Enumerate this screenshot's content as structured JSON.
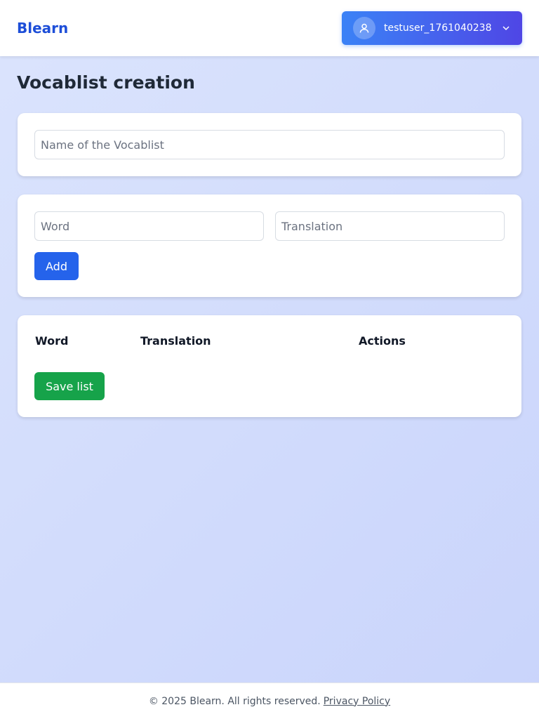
{
  "header": {
    "brand": "Blearn",
    "user": {
      "username": "testuser_1761040238",
      "avatar_icon": "user-icon",
      "dropdown_icon": "chevron-down-icon"
    }
  },
  "page": {
    "title": "Vocablist creation"
  },
  "name_card": {
    "name_placeholder": "Name of the Vocablist",
    "name_value": ""
  },
  "add_card": {
    "word_placeholder": "Word",
    "translation_placeholder": "Translation",
    "add_label": "Add"
  },
  "table_card": {
    "columns": [
      "Word",
      "Translation",
      "Actions"
    ],
    "rows": [],
    "save_label": "Save list"
  },
  "footer": {
    "copyright": "© 2025 Blearn. All rights reserved.",
    "privacy_link": "Privacy Policy"
  },
  "colors": {
    "brand": "#1d4ed8",
    "primary_button": "#2563eb",
    "save_button": "#16a34a",
    "user_button_gradient": [
      "#3b82f6",
      "#4f46e5"
    ]
  }
}
